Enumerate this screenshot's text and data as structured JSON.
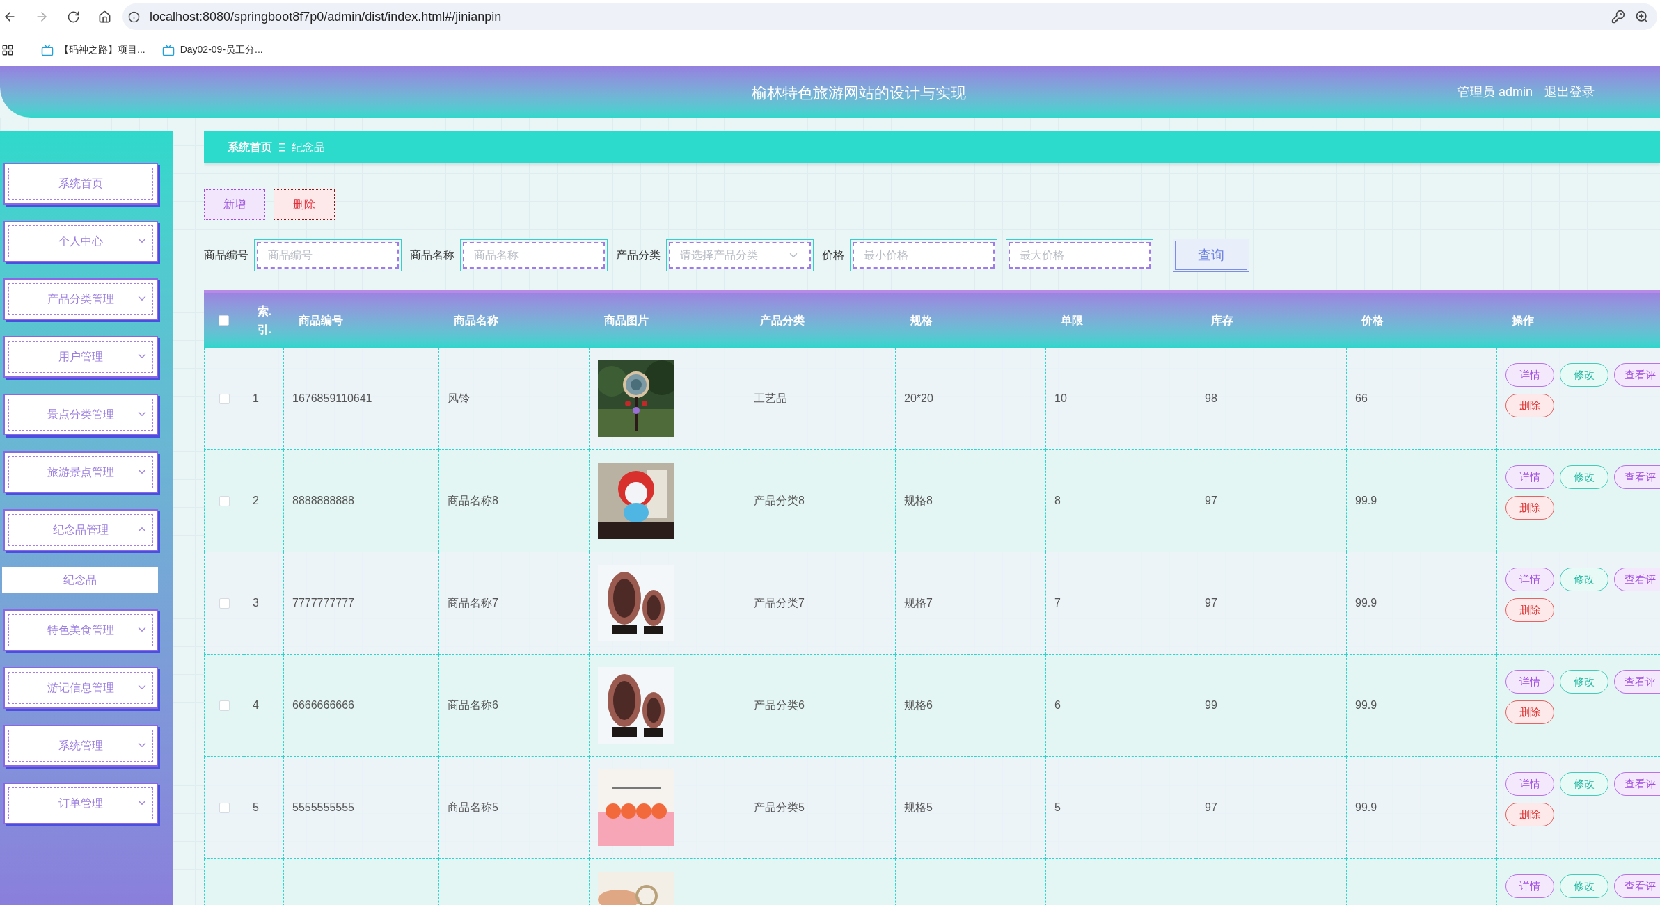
{
  "browser": {
    "url": "localhost:8080/springboot8f7p0/admin/dist/index.html#/jinianpin",
    "bookmarks": [
      "【码神之路】项目...",
      "Day02-09-员工分..."
    ]
  },
  "header": {
    "title": "榆林特色旅游网站的设计与实现",
    "user": "管理员 admin",
    "logout": "退出登录"
  },
  "sidebar": {
    "items": [
      {
        "label": "系统首页",
        "kind": "link"
      },
      {
        "label": "个人中心",
        "kind": "menu",
        "expanded": false
      },
      {
        "label": "产品分类管理",
        "kind": "menu",
        "expanded": false
      },
      {
        "label": "用户管理",
        "kind": "menu",
        "expanded": false
      },
      {
        "label": "景点分类管理",
        "kind": "menu",
        "expanded": false
      },
      {
        "label": "旅游景点管理",
        "kind": "menu",
        "expanded": false
      },
      {
        "label": "纪念品管理",
        "kind": "menu",
        "expanded": true,
        "children": [
          {
            "label": "纪念品",
            "selected": true
          }
        ]
      },
      {
        "label": "特色美食管理",
        "kind": "menu",
        "expanded": false
      },
      {
        "label": "游记信息管理",
        "kind": "menu",
        "expanded": false
      },
      {
        "label": "系统管理",
        "kind": "menu",
        "expanded": false
      },
      {
        "label": "订单管理",
        "kind": "menu",
        "expanded": false
      }
    ]
  },
  "breadcrumb": [
    "系统首页",
    "纪念品"
  ],
  "toolbar": [
    {
      "label": "新增",
      "kind": "add"
    },
    {
      "label": "删除",
      "kind": "delete"
    }
  ],
  "filters": [
    {
      "label": "商品编号",
      "placeholder": "商品编号",
      "kind": "text"
    },
    {
      "label": "商品名称",
      "placeholder": "商品名称",
      "kind": "text"
    },
    {
      "label": "产品分类",
      "placeholder": "请选择产品分类",
      "kind": "select"
    },
    {
      "label": "价格",
      "placeholder": "最小价格",
      "kind": "text"
    },
    {
      "placeholder": "最大价格",
      "kind": "text"
    }
  ],
  "search_button": "查询",
  "table": {
    "select_all": {
      "checked": false
    },
    "columns": [
      "索.引.",
      "商品编号",
      "商品名称",
      "商品图片",
      "产品分类",
      "规格",
      "单限",
      "库存",
      "价格",
      "操作"
    ],
    "rows": [
      {
        "checked": false,
        "cells": [
          "1",
          "1676859110641",
          "风铃",
          "工艺品",
          "20*20",
          "10",
          "98",
          "66"
        ],
        "actions": [
          {
            "label": "详情",
            "kind": "detail"
          },
          {
            "label": "修改",
            "kind": "edit"
          },
          {
            "label": "查看评",
            "kind": "review"
          },
          {
            "label": "删除",
            "kind": "delete"
          }
        ]
      },
      {
        "checked": false,
        "cells": [
          "2",
          "8888888888",
          "商品名称8",
          "产品分类8",
          "规格8",
          "8",
          "97",
          "99.9"
        ],
        "actions": [
          {
            "label": "详情",
            "kind": "detail"
          },
          {
            "label": "修改",
            "kind": "edit"
          },
          {
            "label": "查看评",
            "kind": "review"
          },
          {
            "label": "删除",
            "kind": "delete"
          }
        ]
      },
      {
        "checked": false,
        "cells": [
          "3",
          "7777777777",
          "商品名称7",
          "产品分类7",
          "规格7",
          "7",
          "97",
          "99.9"
        ],
        "actions": [
          {
            "label": "详情",
            "kind": "detail"
          },
          {
            "label": "修改",
            "kind": "edit"
          },
          {
            "label": "查看评",
            "kind": "review"
          },
          {
            "label": "删除",
            "kind": "delete"
          }
        ]
      },
      {
        "checked": false,
        "cells": [
          "4",
          "6666666666",
          "商品名称6",
          "产品分类6",
          "规格6",
          "6",
          "99",
          "99.9"
        ],
        "actions": [
          {
            "label": "详情",
            "kind": "detail"
          },
          {
            "label": "修改",
            "kind": "edit"
          },
          {
            "label": "查看评",
            "kind": "review"
          },
          {
            "label": "删除",
            "kind": "delete"
          }
        ]
      },
      {
        "checked": false,
        "cells": [
          "5",
          "5555555555",
          "商品名称5",
          "产品分类5",
          "规格5",
          "5",
          "97",
          "99.9"
        ],
        "actions": [
          {
            "label": "详情",
            "kind": "detail"
          },
          {
            "label": "修改",
            "kind": "edit"
          },
          {
            "label": "查看评",
            "kind": "review"
          },
          {
            "label": "删除",
            "kind": "delete"
          }
        ]
      },
      {
        "actions": [
          {
            "label": "详情",
            "kind": "detail"
          },
          {
            "label": "修改",
            "kind": "edit"
          },
          {
            "label": "查看评",
            "kind": "review"
          }
        ]
      }
    ]
  }
}
